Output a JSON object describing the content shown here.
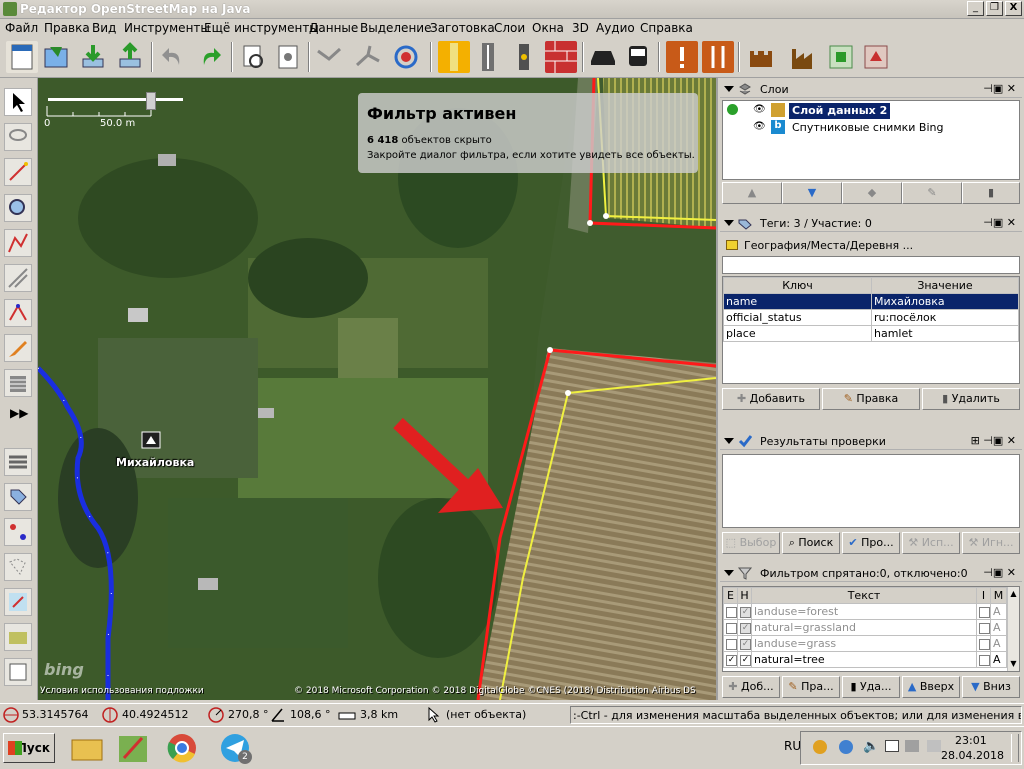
{
  "window": {
    "title": "Редактор OpenStreetMap на Java",
    "min_btn": "_",
    "max_btn": "❐",
    "close_btn": "X"
  },
  "menu": [
    "Файл",
    "Правка",
    "Вид",
    "Инструменты",
    "Ещё инструменты",
    "Данные",
    "Выделение",
    "Заготовка",
    "Слои",
    "Окна",
    "3D",
    "Аудио",
    "Справка"
  ],
  "map": {
    "filter_title": "Фильтр активен",
    "filter_hidden_count": "6 418",
    "filter_hidden_text": "объектов скрыто",
    "filter_hint": "Закройте диалог фильтра, если хотите увидеть все объекты.",
    "scale_left": "0",
    "scale_right": "50.0 m",
    "place_label": "Михайловка",
    "bing_logo": "bing",
    "terms_link": "Условия использования подложки",
    "copyright": "© 2018 Microsoft Corporation © 2018 DigitalGlobe ©CNES (2018) Distribution Airbus DS"
  },
  "layers": {
    "title": "Слои",
    "items": [
      {
        "name": "Слой данных 2",
        "active": true
      },
      {
        "name": "Спутниковые снимки Bing",
        "active": false
      }
    ]
  },
  "tags": {
    "title": "Теги: 3 / Участие: 0",
    "preset": "География/Места/Деревня ...",
    "col_key": "Ключ",
    "col_value": "Значение",
    "rows": [
      {
        "key": "name",
        "value": "Михайловка"
      },
      {
        "key": "official_status",
        "value": "ru:посёлок"
      },
      {
        "key": "place",
        "value": "hamlet"
      }
    ],
    "btn_add": "Добавить",
    "btn_edit": "Правка",
    "btn_delete": "Удалить"
  },
  "validation": {
    "title": "Результаты проверки",
    "btn_select": "Выбор",
    "btn_search": "Поиск",
    "btn_validate": "Про...",
    "btn_fix": "Исп...",
    "btn_ignore": "Игн..."
  },
  "filter": {
    "title": "Фильтром спрятано:0, отключено:0",
    "col_e": "E",
    "col_h": "H",
    "col_text": "Текст",
    "col_i": "I",
    "col_m": "M",
    "rows": [
      {
        "text": "landuse=forest",
        "enabled": false,
        "mode": "A"
      },
      {
        "text": "natural=grassland",
        "enabled": false,
        "mode": "A"
      },
      {
        "text": "landuse=grass",
        "enabled": false,
        "mode": "A"
      },
      {
        "text": "natural=tree",
        "enabled": true,
        "mode": "A"
      }
    ],
    "btn_add": "Доб...",
    "btn_edit": "Пра...",
    "btn_delete": "Уда...",
    "btn_up": "Вверх",
    "btn_down": "Вниз"
  },
  "status": {
    "lat": "53.3145764",
    "lon": "40.4924512",
    "heading": "270,8 °",
    "angle": "108,6 °",
    "length": "3,8 km",
    "object": "(нет объекта)",
    "hint": ":-Ctrl - для изменения масштаба выделенных объектов; или для изменения выделения"
  },
  "taskbar": {
    "start": "Пуск",
    "lang": "RU",
    "time": "23:01",
    "date": "28.04.2018",
    "telegram_badge": "2"
  },
  "colors": {
    "selection": "#0a246a",
    "track_blue": "#1a2ee0",
    "red_way": "#ff1a1a",
    "yellow_way": "#f0f040"
  }
}
